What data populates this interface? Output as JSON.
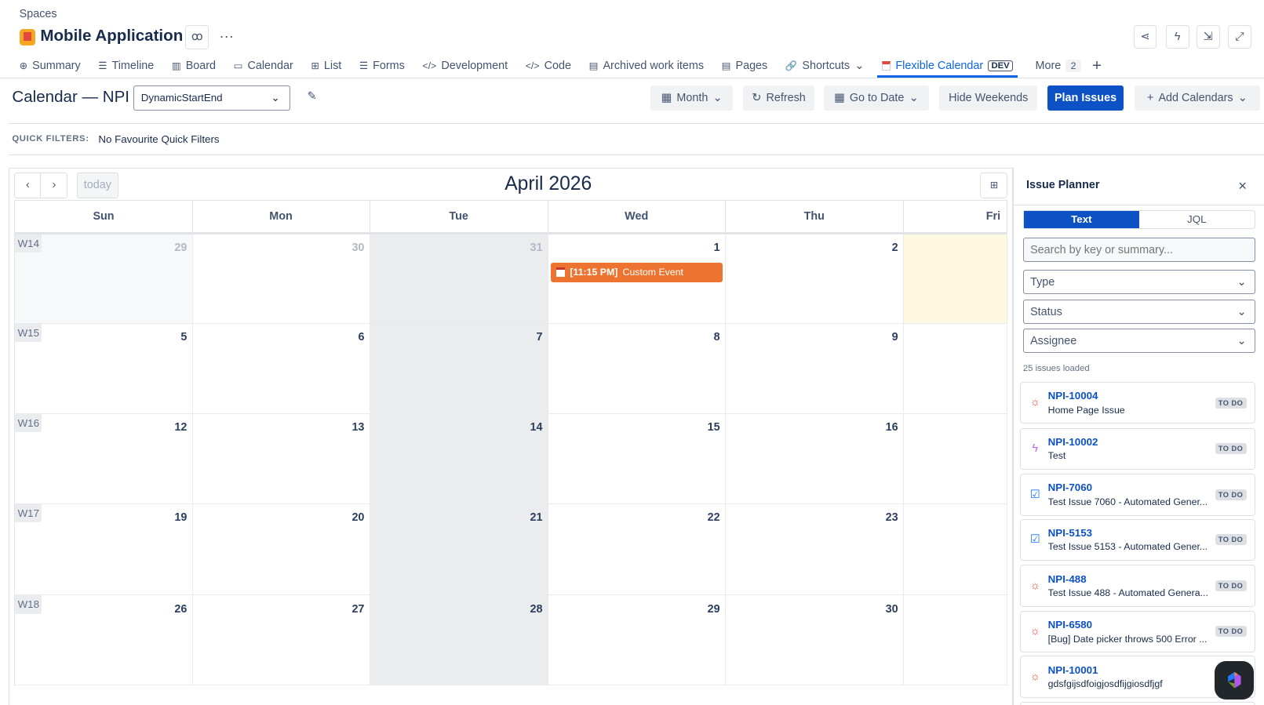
{
  "header": {
    "breadcrumb": "Spaces",
    "project_title": "Mobile Application",
    "more_dots": "···"
  },
  "tabs": [
    {
      "label": "Summary",
      "icon": "globe-icon",
      "glyph": "⊕"
    },
    {
      "label": "Timeline",
      "icon": "timeline-icon",
      "glyph": "☰"
    },
    {
      "label": "Board",
      "icon": "board-icon",
      "glyph": "▥"
    },
    {
      "label": "Calendar",
      "icon": "calendar-icon",
      "glyph": "▭"
    },
    {
      "label": "List",
      "icon": "list-icon",
      "glyph": "⊞"
    },
    {
      "label": "Forms",
      "icon": "forms-icon",
      "glyph": "☰"
    },
    {
      "label": "Development",
      "icon": "development-icon",
      "glyph": "</>"
    },
    {
      "label": "Code",
      "icon": "code-icon",
      "glyph": "</>"
    },
    {
      "label": "Archived work items",
      "icon": "archive-icon",
      "glyph": "▤"
    },
    {
      "label": "Pages",
      "icon": "pages-icon",
      "glyph": "▤"
    },
    {
      "label": "Shortcuts",
      "icon": "link-icon",
      "glyph": "🔗"
    }
  ],
  "active_tab": {
    "label": "Flexible Calendar",
    "badge": "DEV"
  },
  "more_tab": {
    "label": "More",
    "count": "2"
  },
  "toolbar": {
    "title": "Calendar — NPI",
    "select_value": "DynamicStartEnd",
    "month": "Month",
    "refresh": "Refresh",
    "go_to_date": "Go to Date",
    "hide_weekends": "Hide Weekends",
    "plan_issues": "Plan Issues",
    "add_calendars": "Add Calendars"
  },
  "quick_filters": {
    "label": "QUICK FILTERS:",
    "value": "No Favourite Quick Filters"
  },
  "calendar": {
    "prev": "‹",
    "next": "›",
    "today": "today",
    "title": "April 2026",
    "days": [
      "Sun",
      "Mon",
      "Tue",
      "Wed",
      "Thu",
      "Fri"
    ],
    "weeks": [
      {
        "label": "W14",
        "dates": [
          "29",
          "30",
          "31",
          "1",
          "2",
          ""
        ]
      },
      {
        "label": "W15",
        "dates": [
          "5",
          "6",
          "7",
          "8",
          "9",
          ""
        ]
      },
      {
        "label": "W16",
        "dates": [
          "12",
          "13",
          "14",
          "15",
          "16",
          ""
        ]
      },
      {
        "label": "W17",
        "dates": [
          "19",
          "20",
          "21",
          "22",
          "23",
          ""
        ]
      },
      {
        "label": "W18",
        "dates": [
          "26",
          "27",
          "28",
          "29",
          "30",
          ""
        ]
      }
    ],
    "event": {
      "time": "[11:15 PM]",
      "title": "Custom Event"
    },
    "colors": {
      "event": "#ed7430",
      "today": "#fff8e1",
      "tue": "#ebeced"
    }
  },
  "planner": {
    "title": "Issue Planner",
    "tab_text": "Text",
    "tab_jql": "JQL",
    "search_placeholder": "Search by key or summary...",
    "type": "Type",
    "status": "Status",
    "assignee": "Assignee",
    "loaded": "25 issues loaded",
    "issues": [
      {
        "key": "NPI-10004",
        "summary": "Home Page Issue",
        "status": "TO DO",
        "type": "bug"
      },
      {
        "key": "NPI-10002",
        "summary": "Test",
        "status": "TO DO",
        "type": "epic"
      },
      {
        "key": "NPI-7060",
        "summary": "Test Issue 7060 - Automated Gener...",
        "status": "TO DO",
        "type": "task"
      },
      {
        "key": "NPI-5153",
        "summary": "Test Issue 5153 - Automated Gener...",
        "status": "TO DO",
        "type": "task"
      },
      {
        "key": "NPI-488",
        "summary": "Test Issue 488 - Automated Genera...",
        "status": "TO DO",
        "type": "bug"
      },
      {
        "key": "NPI-6580",
        "summary": "[Bug] Date picker throws 500 Error ...",
        "status": "TO DO",
        "type": "bug"
      },
      {
        "key": "NPI-10001",
        "summary": "gdsfgijsdfoigjosdfijgiosdfjgf",
        "status": "",
        "type": "bug"
      }
    ]
  }
}
